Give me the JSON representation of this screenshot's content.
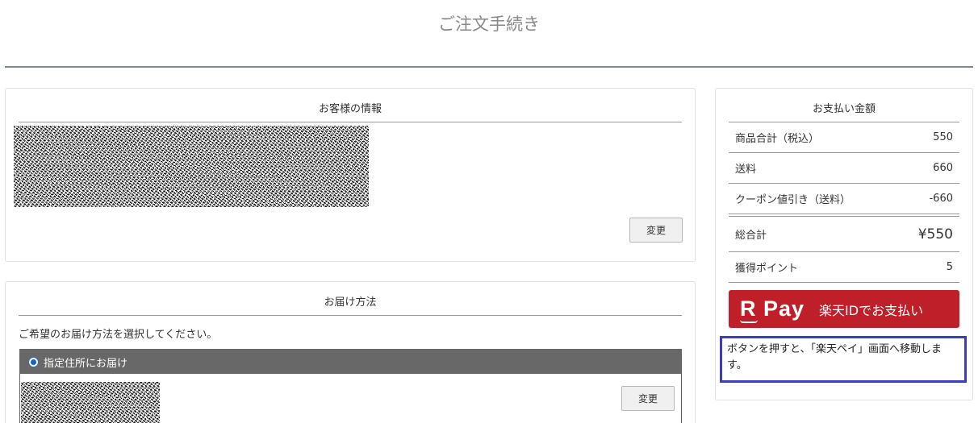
{
  "page": {
    "title": "ご注文手続き"
  },
  "customer": {
    "section_title": "お客様の情報",
    "change_label": "変更"
  },
  "delivery": {
    "section_title": "お届け方法",
    "prompt": "ご希望のお届け方法を選択してください。",
    "selected_method": "指定住所にお届け",
    "change_label": "変更"
  },
  "payment": {
    "section_title": "お支払い金額",
    "rows": [
      {
        "label": "商品合計（税込）",
        "value": "550"
      },
      {
        "label": "送料",
        "value": "660"
      },
      {
        "label": "クーポン値引き（送料）",
        "value": "-660"
      }
    ],
    "total": {
      "label": "総合計",
      "value": "¥550"
    },
    "points": {
      "label": "獲得ポイント",
      "value": "5"
    },
    "rpay_logo": "R Pay",
    "rpay_label": "楽天IDでお支払い",
    "note": "ボタンを押すと、「楽天ペイ」画面へ移動します。"
  },
  "colors": {
    "rpay_red": "#bf1f28",
    "note_border": "#3a3fb5",
    "method_header": "#686868"
  }
}
